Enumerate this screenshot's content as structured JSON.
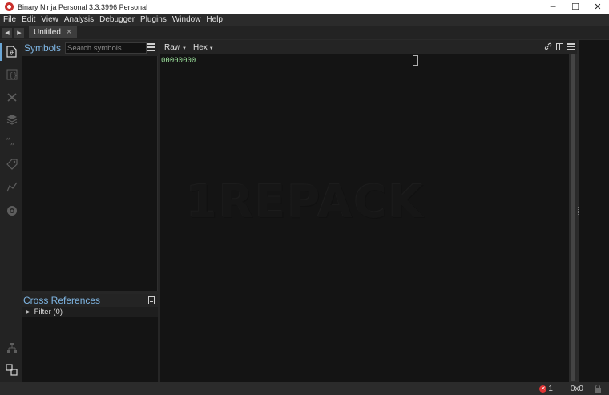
{
  "window": {
    "title": "Binary Ninja Personal 3.3.3996 Personal",
    "minimize_glyph": "─",
    "maximize_glyph": "☐",
    "close_glyph": "✕"
  },
  "menu": [
    "File",
    "Edit",
    "View",
    "Analysis",
    "Debugger",
    "Plugins",
    "Window",
    "Help"
  ],
  "tabs": {
    "back_glyph": "◀",
    "forward_glyph": "▶",
    "active_label": "Untitled",
    "close_glyph": "✕"
  },
  "sidebar_icons": [
    "symbols-icon",
    "types-icon",
    "variables-icon",
    "stack-icon",
    "strings-icon",
    "tags-icon",
    "mini-graph-icon",
    "target-icon",
    "hierarchy-icon",
    "cross-reference-icon"
  ],
  "symbols_panel": {
    "title": "Symbols",
    "search_placeholder": "Search symbols"
  },
  "xrefs_panel": {
    "title": "Cross References",
    "filter_label": "Filter (0)"
  },
  "view": {
    "mode_label": "Raw",
    "format_label": "Hex",
    "hex_address": "00000000",
    "watermark": "1REPACK"
  },
  "status": {
    "error_count": "1",
    "offset": "0x0"
  },
  "colors": {
    "accent": "#7fb6e4",
    "hex_address": "#9be19b",
    "error": "#dd3333"
  }
}
